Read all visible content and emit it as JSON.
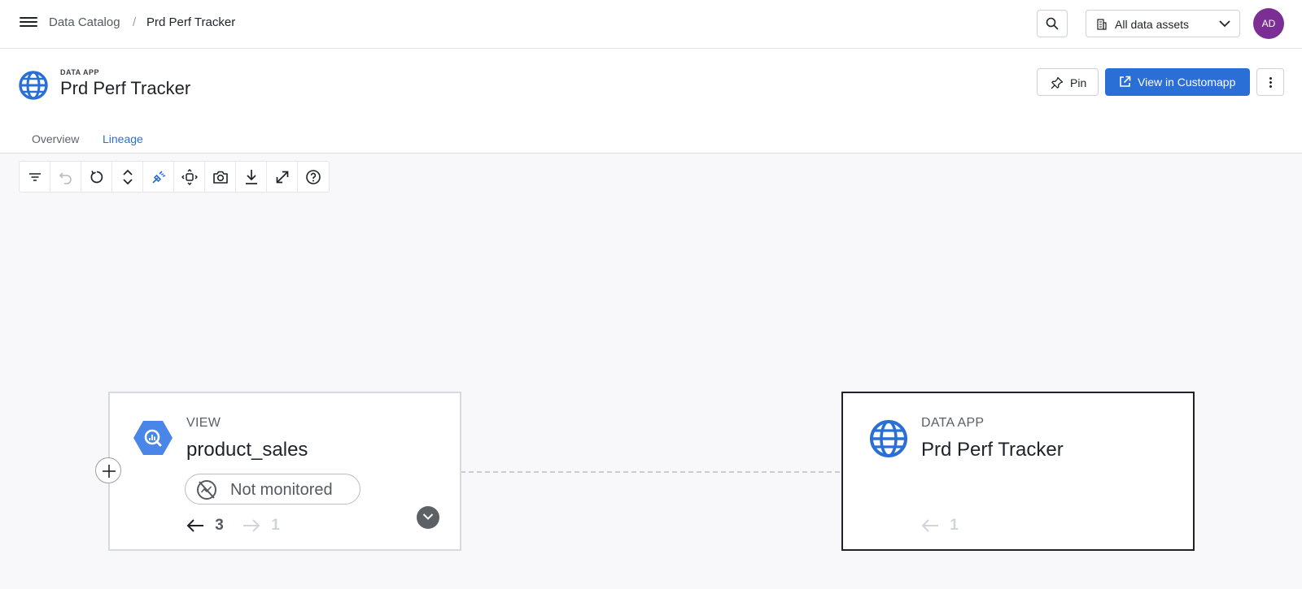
{
  "breadcrumb": {
    "root": "Data Catalog",
    "separator": "/",
    "current": "Prd Perf Tracker"
  },
  "asset_select": {
    "label": "All data assets"
  },
  "user": {
    "initials": "AD",
    "avatar_color": "#7b2f95"
  },
  "header": {
    "kind": "DATA APP",
    "title": "Prd Perf Tracker",
    "pin_label": "Pin",
    "view_label": "View in Customapp"
  },
  "tabs": [
    {
      "label": "Overview",
      "active": false
    },
    {
      "label": "Lineage",
      "active": true
    }
  ],
  "toolbar": {
    "tools": [
      "filter-icon",
      "undo-icon",
      "refresh-icon",
      "expand-collapse-icon",
      "highlight-icon",
      "fit-view-icon",
      "screenshot-icon",
      "download-icon",
      "fullscreen-icon",
      "help-icon"
    ]
  },
  "nodes": [
    {
      "kind": "VIEW",
      "title": "product_sales",
      "badge": "Not monitored",
      "upstream_count": "3",
      "downstream_count": "1"
    },
    {
      "kind": "DATA APP",
      "title": "Prd Perf Tracker",
      "upstream_count": "1"
    }
  ],
  "colors": {
    "accent": "#2a6fd6",
    "selected_border": "#1f2329"
  }
}
